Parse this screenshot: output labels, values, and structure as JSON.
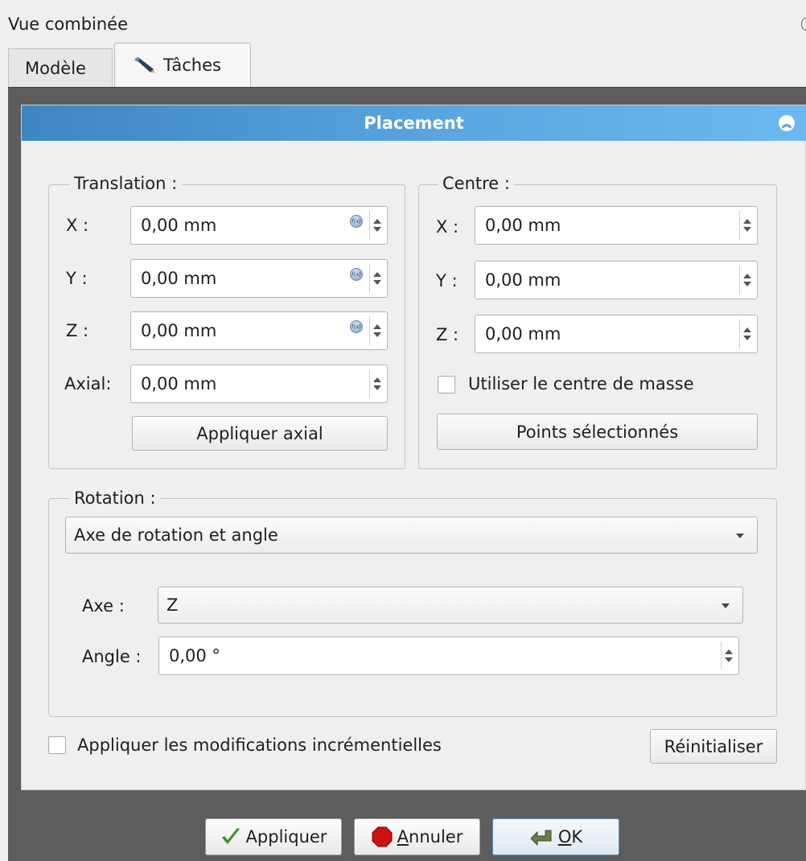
{
  "window": {
    "title": "Vue combinée"
  },
  "tabs": [
    {
      "label": "Modèle",
      "active": false,
      "icon": ""
    },
    {
      "label": "Tâches",
      "active": true,
      "icon": "pencil-icon"
    }
  ],
  "panel": {
    "title": "Placement",
    "collapse_icon": "chevron-double-up-icon",
    "accent_color": "#4a96d2",
    "translation": {
      "title": "Translation :",
      "fields": [
        {
          "label": "X :",
          "value": "0,00 mm"
        },
        {
          "label": "Y :",
          "value": "0,00 mm"
        },
        {
          "label": "Z :",
          "value": "0,00 mm"
        },
        {
          "label": "Axial:",
          "value": "0,00 mm"
        }
      ],
      "apply_axial": "Appliquer axial"
    },
    "center": {
      "title": "Centre :",
      "fields": [
        {
          "label": "X :",
          "value": "0,00 mm"
        },
        {
          "label": "Y :",
          "value": "0,00 mm"
        },
        {
          "label": "Z :",
          "value": "0,00 mm"
        }
      ],
      "use_center_of_mass": {
        "label": "Utiliser le centre de masse",
        "checked": false
      },
      "selected_points": "Points sélectionnés"
    },
    "rotation": {
      "title": "Rotation :",
      "mode": "Axe de rotation et angle",
      "axis_label": "Axe :",
      "axis_value": "Z",
      "angle_label": "Angle :",
      "angle_value": "0,00 °"
    },
    "incremental": {
      "label": "Appliquer les modifications incrémentielles",
      "checked": false
    },
    "reset": "Réinitialiser"
  },
  "dialog_buttons": {
    "apply": "Appliquer",
    "cancel_first": "A",
    "cancel_rest": "nnuler",
    "ok_first": "O",
    "ok_rest": "K"
  }
}
